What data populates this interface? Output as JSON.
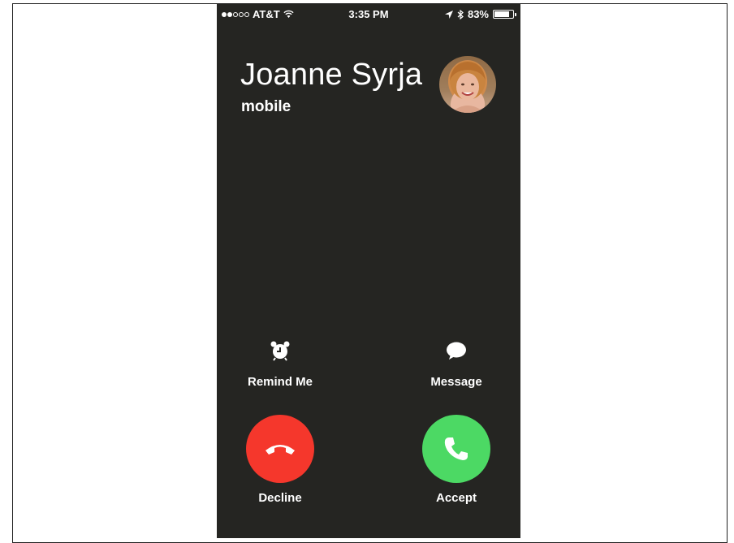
{
  "status_bar": {
    "signal_dots_full": 2,
    "signal_dots_total": 5,
    "carrier": "AT&T",
    "wifi_icon": "wifi-icon",
    "time": "3:35 PM",
    "location_icon": "location-arrow-icon",
    "bluetooth_icon": "bluetooth-icon",
    "battery_percent_text": "83%",
    "battery_level": 0.83
  },
  "caller": {
    "name": "Joanne Syrja",
    "label": "mobile",
    "avatar": "caller-photo"
  },
  "actions": {
    "remind": {
      "label": "Remind Me",
      "icon": "alarm-clock-icon"
    },
    "message": {
      "label": "Message",
      "icon": "speech-bubble-icon"
    },
    "decline": {
      "label": "Decline",
      "icon": "hang-up-icon",
      "color": "#f5372c"
    },
    "accept": {
      "label": "Accept",
      "icon": "phone-icon",
      "color": "#4cd964"
    }
  },
  "colors": {
    "background": "#252522",
    "text": "#ffffff"
  }
}
